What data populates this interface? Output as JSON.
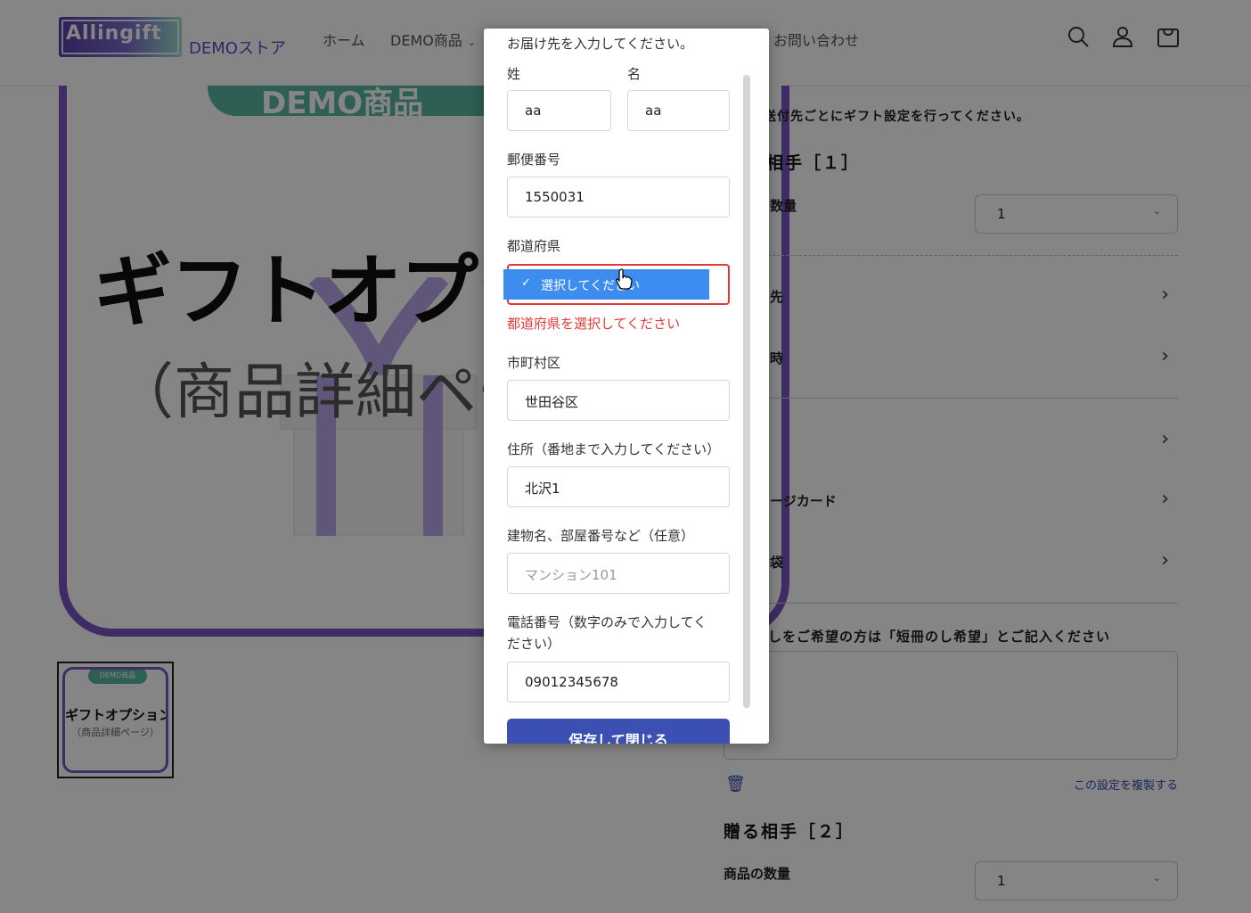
{
  "header": {
    "logo_text": "Allingift",
    "store_name": "DEMOストア",
    "nav": [
      "ホーム",
      "DEMO商品",
      "お問い合わせ"
    ],
    "icons": [
      "search-icon",
      "account-icon",
      "cart-icon"
    ]
  },
  "hero": {
    "pill": "DEMO商品",
    "title": "ギフトオプシ",
    "subtitle": "（商品詳細ペー"
  },
  "thumbnail": {
    "pill": "DEMO商品",
    "title": "ギフトオプション",
    "subtitle": "（商品詳細ページ）"
  },
  "right": {
    "note": "をする送付先ごとにギフト設定を行ってください。",
    "recipient1": "相手［１］",
    "qty_label1": "数量",
    "qty_value1": "1",
    "rows": [
      "先",
      "時",
      "",
      "ージカード",
      "袋"
    ],
    "noshi_label": "しをご希望の方は「短冊のし希望」とご記入ください",
    "copy_link": "この設定を複製する",
    "recipient2": "贈る相手［２］",
    "qty_label2": "商品の数量",
    "qty_value2": "1"
  },
  "modal": {
    "intro": "お届け先を入力してください。",
    "last_name_label": "姓",
    "first_name_label": "名",
    "last_name_value": "aa",
    "first_name_value": "aa",
    "postal_label": "郵便番号",
    "postal_value": "1550031",
    "pref_label": "都道府県",
    "pref_option": "選択してください",
    "pref_error": "都道府県を選択してください",
    "city_label": "市町村区",
    "city_value": "世田谷区",
    "address_label": "住所（番地まで入力してください）",
    "address_value": "北沢1",
    "building_label": "建物名、部屋番号など（任意）",
    "building_placeholder": "マンション101",
    "phone_label_line1": "電話番号（数字のみで入力してく",
    "phone_label_line2": "ださい）",
    "phone_value": "09012345678",
    "save_button": "保存して閉じる"
  },
  "colors": {
    "brand_purple": "#7a55c6",
    "teal": "#57b7a2",
    "error": "#e53935",
    "selected": "#3d8cf0",
    "button": "#3c4fb3"
  }
}
